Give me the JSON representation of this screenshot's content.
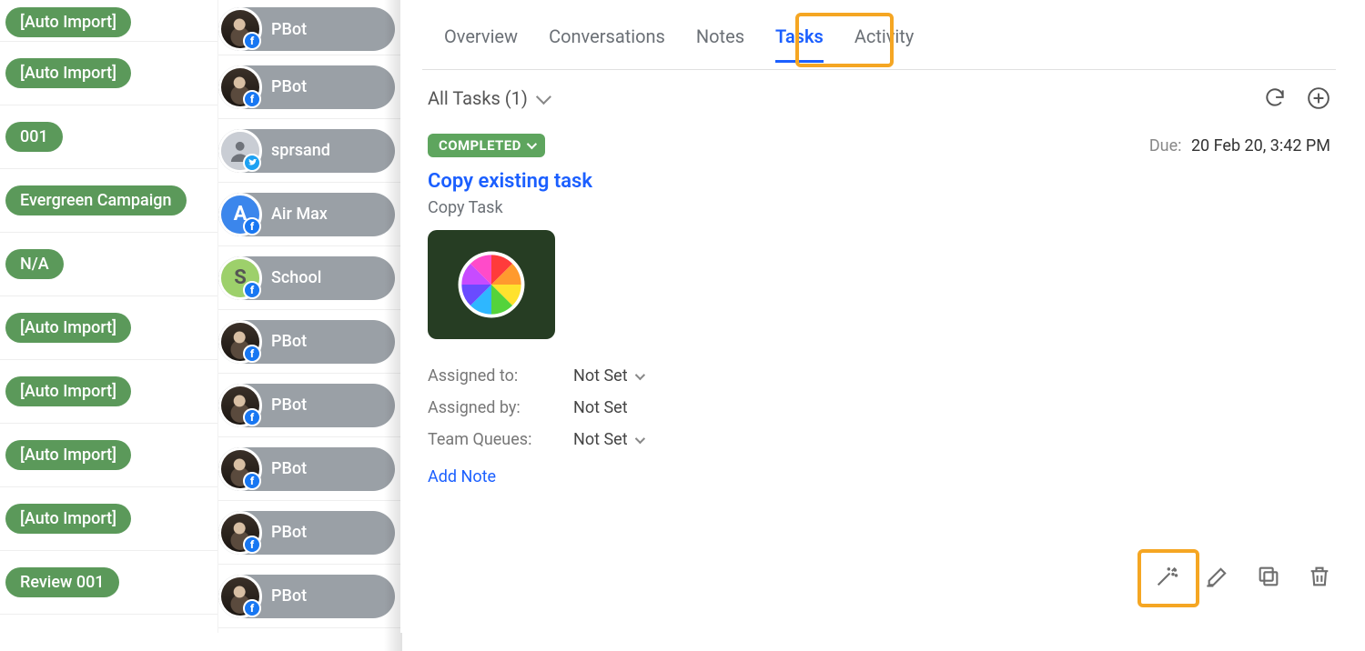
{
  "colors": {
    "accent": "#1b5fff",
    "highlight": "#f5a623",
    "tagGreen": "#5b995a",
    "status": "#5ea55e"
  },
  "leftTags": [
    {
      "label": "[Auto Import]"
    },
    {
      "label": "[Auto Import]"
    },
    {
      "label": "001"
    },
    {
      "label": "Evergreen Campaign"
    },
    {
      "label": "N/A"
    },
    {
      "label": "[Auto Import]"
    },
    {
      "label": "[Auto Import]"
    },
    {
      "label": "[Auto Import]"
    },
    {
      "label": "[Auto Import]"
    },
    {
      "label": "Review 001"
    }
  ],
  "contacts": [
    {
      "label": "PBot",
      "avatar": "photo",
      "net": "fb"
    },
    {
      "label": "PBot",
      "avatar": "photo",
      "net": "fb"
    },
    {
      "label": "sprsand",
      "avatar": "gray",
      "net": "tw"
    },
    {
      "label": "Air Max",
      "avatar": "letter",
      "letter": "A",
      "letterClass": "blue",
      "net": "fb"
    },
    {
      "label": "School",
      "avatar": "letter",
      "letter": "S",
      "letterClass": "green",
      "net": "fb"
    },
    {
      "label": "PBot",
      "avatar": "photo",
      "net": "fb"
    },
    {
      "label": "PBot",
      "avatar": "photo",
      "net": "fb"
    },
    {
      "label": "PBot",
      "avatar": "photo",
      "net": "fb"
    },
    {
      "label": "PBot",
      "avatar": "photo",
      "net": "fb"
    },
    {
      "label": "PBot",
      "avatar": "photo",
      "net": "fb"
    }
  ],
  "tabs": {
    "overview": "Overview",
    "conversations": "Conversations",
    "notes": "Notes",
    "tasks": "Tasks",
    "activity": "Activity",
    "active": "tasks"
  },
  "filter": {
    "label": "All Tasks (1)"
  },
  "task": {
    "status": "COMPLETED",
    "due_label": "Due:",
    "due_value": "20 Feb 20, 3:42 PM",
    "title": "Copy existing task",
    "subtitle": "Copy Task",
    "assigned_to_label": "Assigned to:",
    "assigned_to_value": "Not Set",
    "assigned_by_label": "Assigned by:",
    "assigned_by_value": "Not Set",
    "team_queues_label": "Team Queues:",
    "team_queues_value": "Not Set",
    "add_note": "Add Note"
  }
}
